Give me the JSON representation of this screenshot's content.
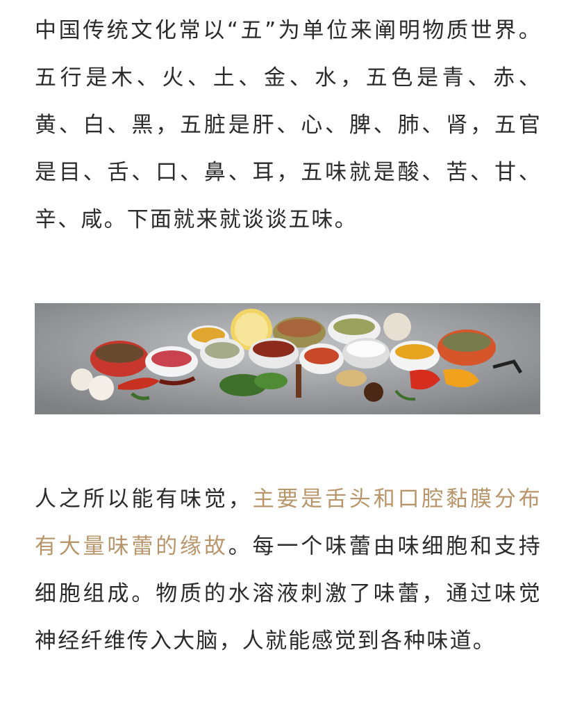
{
  "article": {
    "paragraph1": "中国传统文化常以“五”为单位来阐明物质世界。五行是木、火、土、金、水，五色是青、赤、黄、白、黑，五脏是肝、心、脾、肺、肾，五官是目、舌、口、鼻、耳，五味就是酸、苦、甘、辛、咸。下面就来就谈谈五味。",
    "paragraph2": {
      "lead": "人之所以能有味觉，",
      "highlight": "主要是舌头和口腔黏膜分布有大量味蕾的缘故",
      "rest": "。每一个味蕾由味细胞和支持细胞组成。物质的水溶液刺激了味蕾，通过味觉神经纤维传入大脑，人就能感觉到各种味道。"
    },
    "highlight_color": "#b8956a"
  },
  "banner_image": {
    "icon": "spices-photo"
  }
}
